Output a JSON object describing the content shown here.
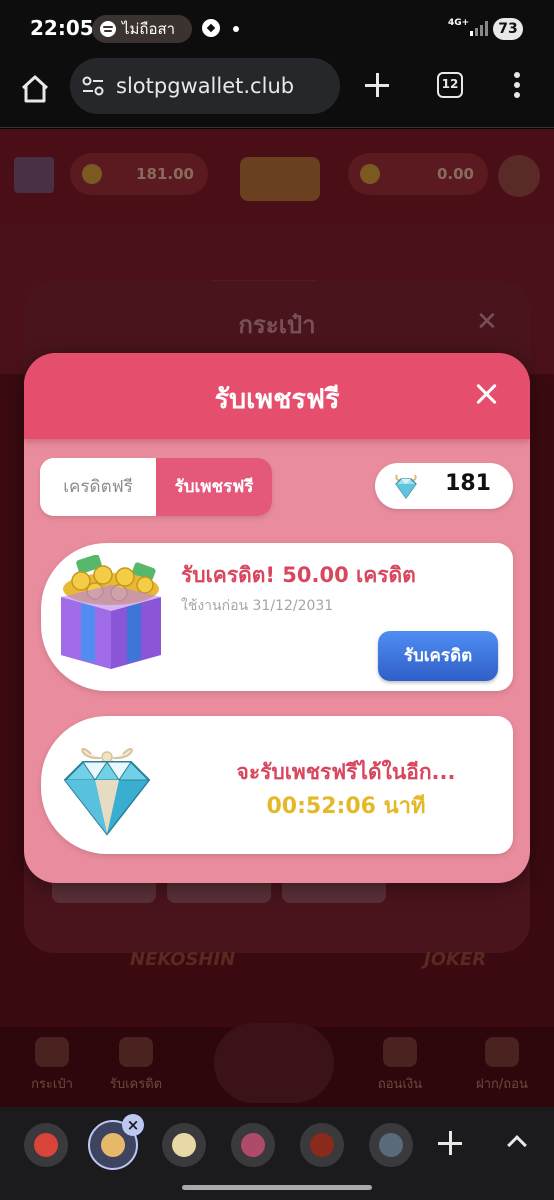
{
  "status_bar": {
    "time": "22:05",
    "notification_pill_text": "ไม่ถือสา",
    "network": "4G+",
    "battery": "73",
    "icons": [
      "spotify-icon",
      "soccer-ball-icon",
      "dot-icon",
      "signal-icon"
    ]
  },
  "browser": {
    "url": "slotpgwallet.club",
    "tab_count": "12",
    "icons": [
      "home-icon",
      "site-settings-icon",
      "new-tab-icon",
      "tab-switcher-icon",
      "more-menu-icon"
    ]
  },
  "background_page": {
    "balance_left": "181.00",
    "balance_right": "0.00",
    "wallet_modal_title": "กระเป๋า",
    "game_labels": [
      "NEKOSHIN",
      "JOKER"
    ],
    "nav_items": [
      "กระเป๋า",
      "รับเครดิต",
      "ถอนเงิน",
      "ฝาก/ถอน"
    ]
  },
  "modal": {
    "title": "รับเพชรฟรี",
    "tabs": [
      {
        "label": "เครดิตฟรี",
        "active": false
      },
      {
        "label": "รับเพชรฟรี",
        "active": true
      }
    ],
    "gem_count": "181",
    "credit_card": {
      "title": "รับเครดิต! 50.00 เครดิต",
      "subtitle": "ใช้งานก่อน 31/12/2031",
      "button_label": "รับเครดิต"
    },
    "gem_card": {
      "wait_text": "จะรับเพชรฟรีได้ในอีก...",
      "timer": "00:52:06 นาที"
    }
  },
  "colors": {
    "modal_body": "#e98c9d",
    "modal_header": "#e54f6d",
    "active_tab": "#e4587a",
    "card_title": "#d9475f",
    "timer": "#e3b928",
    "claim_button": "#3e7ae0"
  }
}
